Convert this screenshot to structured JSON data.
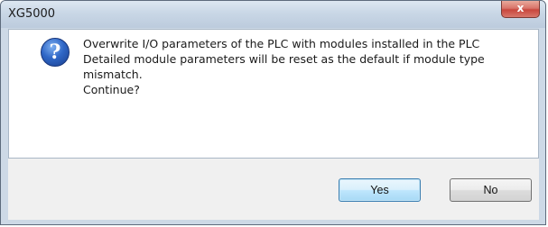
{
  "dialog": {
    "title": "XG5000",
    "close_glyph": "x",
    "icon": "question-icon",
    "message_lines": [
      "Overwrite I/O parameters of the PLC with modules installed in the PLC",
      "Detailed module parameters will be reset as the default if module type",
      "mismatch.",
      "Continue?"
    ],
    "buttons": {
      "yes_label": "Yes",
      "no_label": "No"
    }
  },
  "colors": {
    "title_bar": "#c9d7e6",
    "close_button": "#c8473d",
    "default_button_border": "#3c7fb1",
    "icon_blue": "#2f67c7"
  }
}
